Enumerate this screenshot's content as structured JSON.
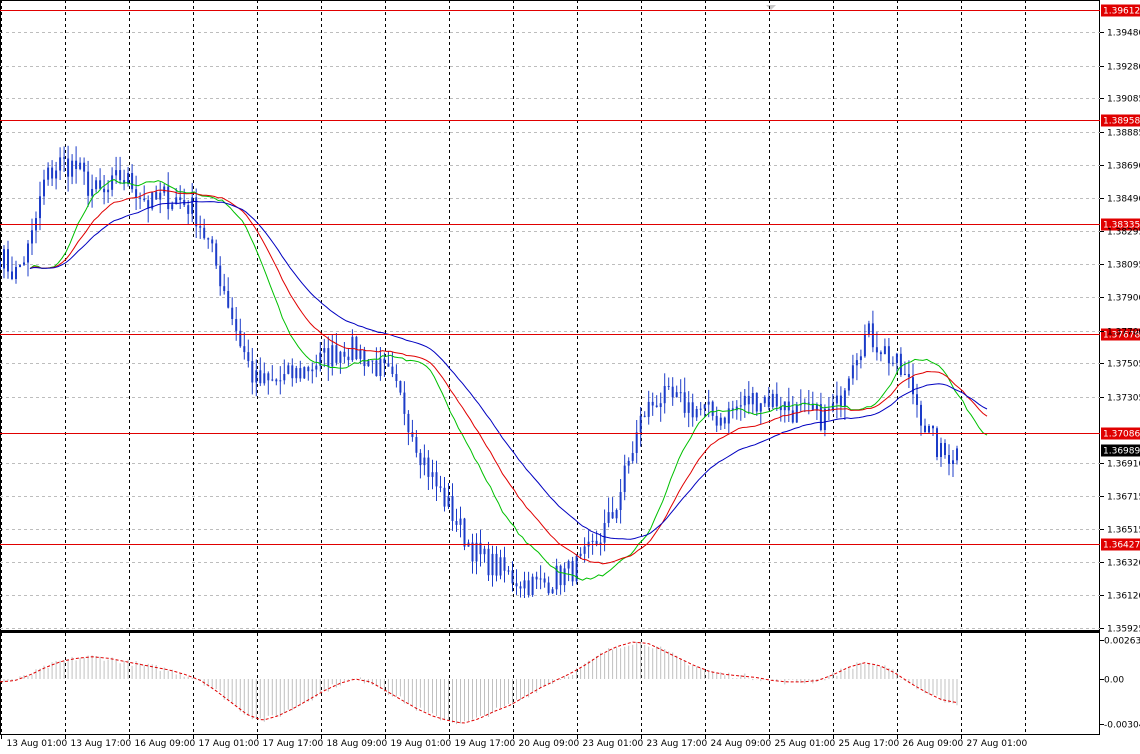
{
  "chart_data": {
    "type": "candlestick",
    "price_axis": {
      "ticks": [
        "1.39480",
        "1.39280",
        "1.39085",
        "1.38885",
        "1.38690",
        "1.38490",
        "1.38295",
        "1.38095",
        "1.37900",
        "1.37700",
        "1.37505",
        "1.37305",
        "1.36910",
        "1.36715",
        "1.36515",
        "1.36320",
        "1.36120",
        "1.35925"
      ],
      "range": [
        1.35925,
        1.3966
      ]
    },
    "time_axis": {
      "labels": [
        "13 Aug 01:00",
        "13 Aug 17:00",
        "16 Aug 09:00",
        "17 Aug 01:00",
        "17 Aug 17:00",
        "18 Aug 09:00",
        "19 Aug 01:00",
        "19 Aug 17:00",
        "20 Aug 09:00",
        "23 Aug 01:00",
        "23 Aug 17:00",
        "24 Aug 09:00",
        "25 Aug 01:00",
        "25 Aug 17:00",
        "26 Aug 09:00",
        "27 Aug 01:00"
      ]
    },
    "levels": [
      {
        "price": 1.39612,
        "label": "1.39612"
      },
      {
        "price": 1.38958,
        "label": "1.38958"
      },
      {
        "price": 1.38335,
        "label": "1.38335"
      },
      {
        "price": 1.37678,
        "label": "1.37678"
      },
      {
        "price": 1.37086,
        "label": "1.37086"
      },
      {
        "price": 1.36427,
        "label": "1.36427"
      }
    ],
    "current_price": {
      "value": 1.36989,
      "label": "1.36989"
    },
    "series_close": [
      1.3815,
      1.3803,
      1.382,
      1.386,
      1.387,
      1.3868,
      1.3855,
      1.385,
      1.3862,
      1.3856,
      1.3845,
      1.385,
      1.3848,
      1.3842,
      1.382,
      1.3795,
      1.3765,
      1.374,
      1.3738,
      1.3741,
      1.3745,
      1.375,
      1.3755,
      1.376,
      1.3757,
      1.375,
      1.3742,
      1.3725,
      1.37,
      1.368,
      1.3665,
      1.3648,
      1.3635,
      1.363,
      1.3624,
      1.362,
      1.3618,
      1.3622,
      1.3626,
      1.3632,
      1.3645,
      1.366,
      1.369,
      1.372,
      1.373,
      1.3728,
      1.3725,
      1.3722,
      1.3718,
      1.3722,
      1.3728,
      1.373,
      1.3728,
      1.3722,
      1.372,
      1.3718,
      1.3725,
      1.3755,
      1.3768,
      1.376,
      1.3748,
      1.3735,
      1.371,
      1.3695,
      1.3698
    ],
    "indicators": [
      {
        "name": "MA fast",
        "color": "#00c000",
        "period": 3
      },
      {
        "name": "MA mid",
        "color": "#e00000",
        "period": 6
      },
      {
        "name": "MA slow",
        "color": "#0000c0",
        "period": 10
      }
    ],
    "oscillator": {
      "ticks": [
        "0.002635",
        "0.00",
        "-0.003045"
      ],
      "range": [
        -0.003045,
        0.002635
      ],
      "signal": [
        -0.0002,
        -0.0001,
        0.0003,
        0.0008,
        0.0012,
        0.0014,
        0.0015,
        0.0014,
        0.0012,
        0.001,
        0.0008,
        0.0006,
        0.0003,
        -0.0001,
        -0.0008,
        -0.0016,
        -0.0024,
        -0.0028,
        -0.0025,
        -0.002,
        -0.0014,
        -0.0008,
        -0.0003,
        0.0,
        -0.0002,
        -0.0008,
        -0.0014,
        -0.002,
        -0.0025,
        -0.0028,
        -0.003,
        -0.0027,
        -0.0022,
        -0.0018,
        -0.0012,
        -0.0006,
        -0.0001,
        0.0004,
        0.001,
        0.0017,
        0.0022,
        0.0025,
        0.0024,
        0.0019,
        0.0014,
        0.0009,
        0.0005,
        0.0003,
        0.0002,
        0.0001,
        -0.0001,
        -0.0002,
        -0.0002,
        -0.0001,
        0.0003,
        0.0008,
        0.0011,
        0.0009,
        0.0004,
        -0.0003,
        -0.0009,
        -0.0014,
        -0.0016
      ]
    }
  }
}
